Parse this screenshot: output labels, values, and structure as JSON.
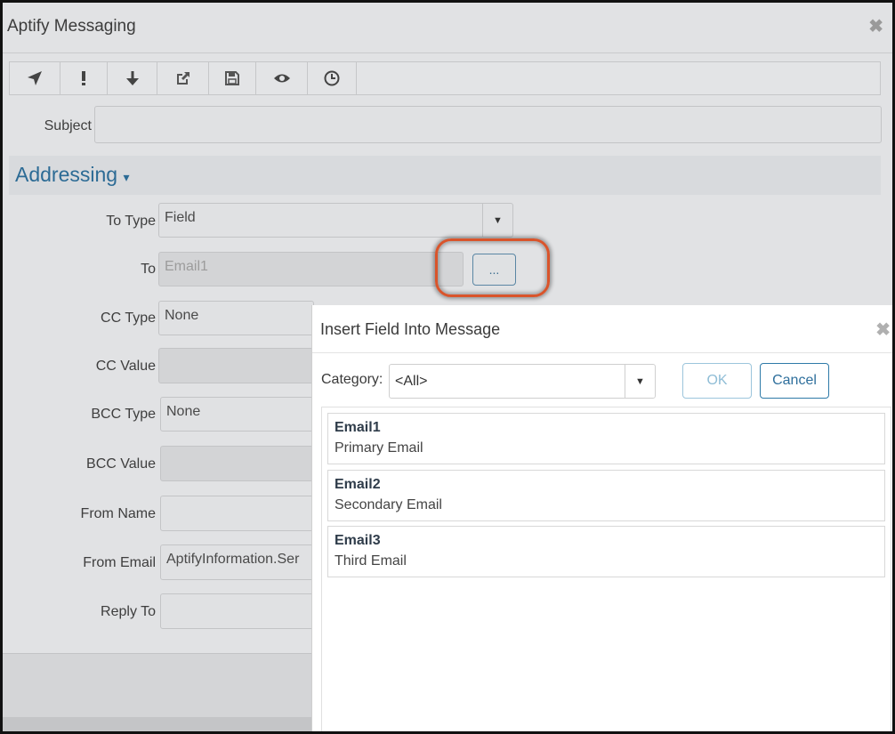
{
  "window": {
    "title": "Aptify Messaging",
    "close": "✖"
  },
  "toolbar": {
    "buttons": [
      {
        "icon": "send-icon"
      },
      {
        "icon": "exclamation-icon"
      },
      {
        "icon": "arrow-down-icon"
      },
      {
        "icon": "external-link-icon"
      },
      {
        "icon": "save-icon"
      },
      {
        "icon": "eye-icon"
      },
      {
        "icon": "clock-icon"
      }
    ]
  },
  "form": {
    "subject_label": "Subject",
    "subject_value": "",
    "section_title": "Addressing",
    "section_caret": "▾",
    "to_type_label": "To Type",
    "to_type_value": "Field",
    "to_label": "To",
    "to_value": "Email1",
    "browse_label": "...",
    "cc_type_label": "CC Type",
    "cc_type_value": "None",
    "cc_value_label": "CC Value",
    "bcc_type_label": "BCC Type",
    "bcc_type_value": "None",
    "bcc_value_label": "BCC Value",
    "from_name_label": "From Name",
    "from_email_label": "From Email",
    "from_email_value": "AptifyInformation.Ser",
    "reply_to_label": "Reply To",
    "dropdown_arrow": "▼"
  },
  "modal": {
    "title": "Insert Field Into Message",
    "close": "✖",
    "category_label": "Category:",
    "category_value": "<All>",
    "dropdown_arrow": "▼",
    "ok_label": "OK",
    "cancel_label": "Cancel",
    "fields": [
      {
        "name": "Email1",
        "description": "Primary Email"
      },
      {
        "name": "Email2",
        "description": "Secondary Email"
      },
      {
        "name": "Email3",
        "description": "Third Email"
      }
    ]
  },
  "colors": {
    "accent": "#2c6b95",
    "highlight": "#d9542b"
  }
}
